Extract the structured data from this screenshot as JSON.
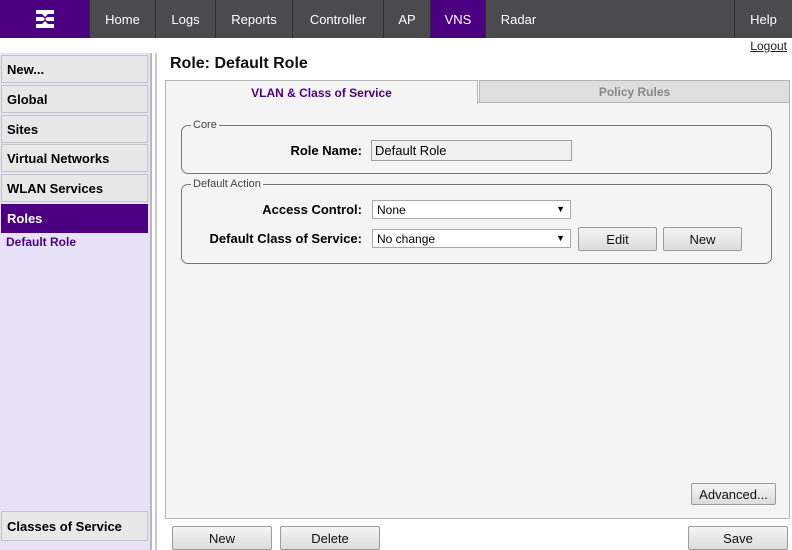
{
  "nav": {
    "items": [
      {
        "label": "Home"
      },
      {
        "label": "Logs"
      },
      {
        "label": "Reports"
      },
      {
        "label": "Controller"
      },
      {
        "label": "AP"
      },
      {
        "label": "VNS"
      },
      {
        "label": "Radar"
      },
      {
        "label": "Help"
      }
    ],
    "active": "VNS",
    "logout": "Logout"
  },
  "sidebar": {
    "items": [
      {
        "label": "New..."
      },
      {
        "label": "Global"
      },
      {
        "label": "Sites"
      },
      {
        "label": "Virtual Networks"
      },
      {
        "label": "WLAN Services"
      },
      {
        "label": "Roles"
      }
    ],
    "sub_item": "Default Role",
    "bottom_item": "Classes of Service"
  },
  "page": {
    "title": "Role: Default Role"
  },
  "tabs": [
    {
      "label": "VLAN & Class of Service",
      "active": true
    },
    {
      "label": "Policy Rules",
      "active": false
    }
  ],
  "core": {
    "legend": "Core",
    "role_name_label": "Role Name:",
    "role_name_value": "Default Role"
  },
  "default_action": {
    "legend": "Default Action",
    "access_control_label": "Access Control:",
    "access_control_value": "None",
    "cos_label": "Default Class of Service:",
    "cos_value": "No change",
    "edit_button": "Edit",
    "new_button": "New"
  },
  "advanced_button": "Advanced...",
  "footer": {
    "new_button": "New",
    "delete_button": "Delete",
    "save_button": "Save"
  },
  "colors": {
    "brand_purple": "#4b0082",
    "topbar": "#4b4b4d",
    "sidebar_bg": "#e7e2f7"
  }
}
